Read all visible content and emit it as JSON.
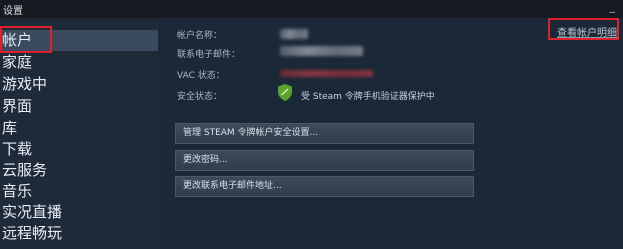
{
  "window": {
    "title": "设置",
    "minimize": "_"
  },
  "sidebar": {
    "items": [
      {
        "label": "帐户"
      },
      {
        "label": "家庭"
      },
      {
        "label": "游戏中"
      },
      {
        "label": "界面"
      },
      {
        "label": "库"
      },
      {
        "label": "下载"
      },
      {
        "label": "云服务"
      },
      {
        "label": "音乐"
      },
      {
        "label": "实况直播"
      },
      {
        "label": "远程畅玩"
      }
    ]
  },
  "account": {
    "name_label": "帐户名称：",
    "email_label": "联系电子邮件：",
    "vac_label": "VAC 状态：",
    "security_label": "安全状态：",
    "security_status": "受 Steam 令牌手机验证器保护中",
    "view_details_link": "查看帐户明细"
  },
  "buttons": {
    "manage_guard": "管理 STEAM 令牌帐户安全设置...",
    "change_password": "更改密码...",
    "change_email": "更改联系电子邮件地址..."
  },
  "colors": {
    "background": "#1b2838",
    "sidebar": "#1f2a38",
    "highlight": "#e0202a",
    "shield": "#5ba32b"
  }
}
